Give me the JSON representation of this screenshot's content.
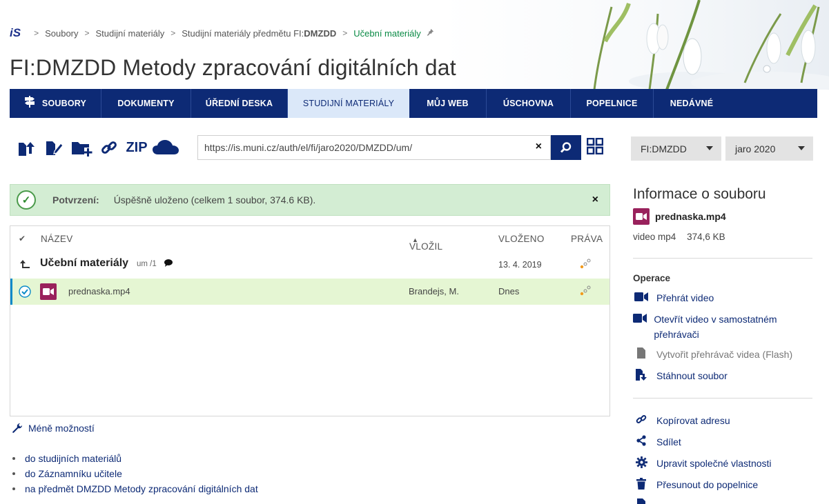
{
  "breadcrumb": {
    "logo": "iS",
    "items": [
      "Soubory",
      "Studijní materiály",
      "Studijní materiály předmětu FI:",
      "Učební materiály"
    ],
    "item3_bold": "DMZDD"
  },
  "page_title": "FI:DMZDD Metody zpracování digitálních dat",
  "nav": {
    "tabs": [
      "SOUBORY",
      "DOKUMENTY",
      "ÚŘEDNÍ DESKA",
      "STUDIJNÍ MATERIÁLY",
      "MŮJ WEB",
      "ÚSCHOVNA",
      "POPELNICE",
      "NEDÁVNÉ"
    ]
  },
  "toolbar": {
    "zip_label": "ZIP",
    "url_value": "https://is.muni.cz/auth/el/fi/jaro2020/DMZDD/um/",
    "clear_label": "×"
  },
  "selects": {
    "course": "FI:DMZDD",
    "term": "jaro 2020"
  },
  "alert": {
    "label": "Potvrzení:",
    "message": "Úspěšně uloženo (celkem 1 soubor, 374.6 KB).",
    "close": "×"
  },
  "table": {
    "headers": {
      "name": "NÁZEV",
      "owner": "VLOŽIL",
      "date": "VLOŽENO",
      "rights": "PRÁVA"
    },
    "sort_indicator": "▲",
    "parent_row": {
      "name": "Učební materiály",
      "suffix": "um /1",
      "date": "13. 4. 2019"
    },
    "file_row": {
      "name": "prednaska.mp4",
      "owner": "Brandejs, M.",
      "date": "Dnes"
    }
  },
  "more_options": "Méně možností",
  "links": [
    "do studijních materiálů",
    "do Záznamníku učitele",
    "na předmět DMZDD Metody zpracování digitálních dat"
  ],
  "info": {
    "title": "Informace o souboru",
    "file_name": "prednaska.mp4",
    "file_type": "video mp4",
    "file_size": "374,6 KB",
    "ops_title": "Operace",
    "ops": [
      "Přehrát video",
      "Otevřít video v samostatném přehrávači",
      "Vytvořit přehrávač videa (Flash)",
      "Stáhnout soubor",
      "Kopírovat adresu",
      "Sdílet",
      "Upravit společné vlastnosti",
      "Přesunout do popelnice"
    ]
  },
  "colors": {
    "nav_bg": "#0d2a75",
    "active_tab_bg": "#dbe8f9",
    "alert_bg": "#d3edd3",
    "selected_row_bg": "#e5f6d3",
    "video_icon_bg": "#99215c",
    "breadcrumb_current": "#0a8a45"
  }
}
